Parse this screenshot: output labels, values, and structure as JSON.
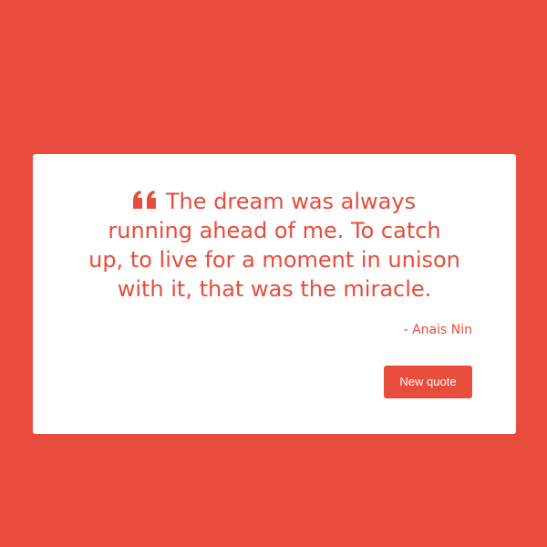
{
  "quote": {
    "text": "The dream was always running ahead of me. To catch up, to live for a moment in unison with it, that was the miracle.",
    "author": "- Anais Nin",
    "icon": "quote-left-icon"
  },
  "actions": {
    "new_quote_label": "New quote"
  },
  "colors": {
    "background": "#e74c3c",
    "card": "#ffffff",
    "accent": "#e74c3c",
    "button_text": "#ffffff"
  }
}
